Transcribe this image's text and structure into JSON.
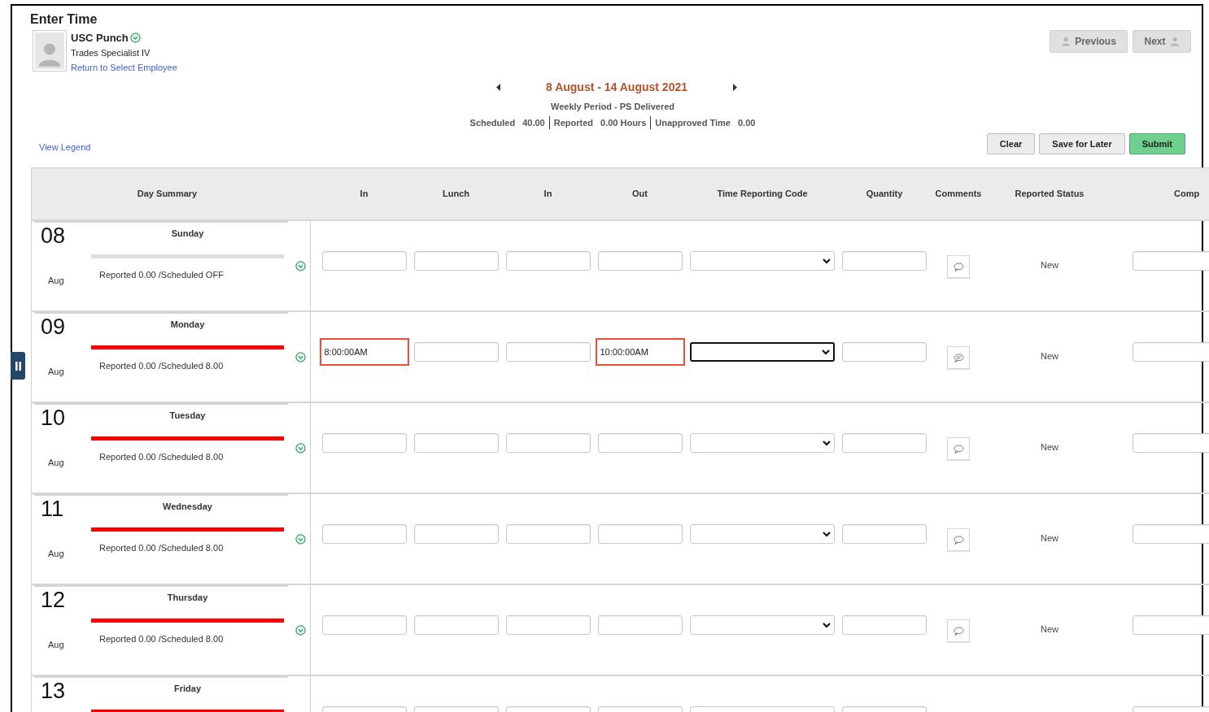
{
  "page_title": "Enter Time",
  "employee": {
    "name": "USC Punch",
    "job": "Trades Specialist IV",
    "return_link": "Return to Select Employee"
  },
  "nav_buttons": [
    "Previous",
    "Next"
  ],
  "period": {
    "title": "8 August - 14 August 2021",
    "subtitle": "Weekly Period - PS Delivered",
    "totals": [
      {
        "label": "Scheduled",
        "value": "40.00"
      },
      {
        "label": "Reported",
        "value": "0.00 Hours"
      },
      {
        "label": "Unapproved Time",
        "value": "0.00"
      }
    ]
  },
  "legend_link": "View Legend",
  "actions": [
    {
      "label": "Clear",
      "kind": "plain"
    },
    {
      "label": "Save for Later",
      "kind": "plain"
    },
    {
      "label": "Submit",
      "kind": "primary"
    }
  ],
  "columns": [
    "Day Summary",
    "In",
    "Lunch",
    "In",
    "Out",
    "Time Reporting Code",
    "Quantity",
    "Comments",
    "Reported Status",
    "Comp"
  ],
  "days": [
    {
      "date": "08",
      "weekday": "Sunday",
      "month": "Aug",
      "color": "#dddddd",
      "summary": "Reported 0.00 /Scheduled OFF",
      "punches": [
        {
          "error": false
        },
        {
          "error": false
        },
        {
          "error": false
        },
        {
          "error": false
        }
      ],
      "trc_focused": false,
      "comment_filled": false,
      "status": "New"
    },
    {
      "date": "09",
      "weekday": "Monday",
      "month": "Aug",
      "color": "#ff0000",
      "summary": "Reported 0.00 /Scheduled 8.00",
      "punches": [
        {
          "value": "8:00:00AM",
          "error": true
        },
        {
          "error": false
        },
        {
          "error": false
        },
        {
          "value": "10:00:00AM",
          "error": true
        }
      ],
      "trc_focused": true,
      "comment_filled": true,
      "status": "New"
    },
    {
      "date": "10",
      "weekday": "Tuesday",
      "month": "Aug",
      "color": "#ff0000",
      "summary": "Reported 0.00 /Scheduled 8.00",
      "punches": [
        {
          "error": false
        },
        {
          "error": false
        },
        {
          "error": false
        },
        {
          "error": false
        }
      ],
      "trc_focused": false,
      "comment_filled": false,
      "status": "New"
    },
    {
      "date": "11",
      "weekday": "Wednesday",
      "month": "Aug",
      "color": "#ff0000",
      "summary": "Reported 0.00 /Scheduled 8.00",
      "punches": [
        {
          "error": false
        },
        {
          "error": false
        },
        {
          "error": false
        },
        {
          "error": false
        }
      ],
      "trc_focused": false,
      "comment_filled": false,
      "status": "New"
    },
    {
      "date": "12",
      "weekday": "Thursday",
      "month": "Aug",
      "color": "#ff0000",
      "summary": "Reported 0.00 /Scheduled 8.00",
      "punches": [
        {
          "error": false
        },
        {
          "error": false
        },
        {
          "error": false
        },
        {
          "error": false
        }
      ],
      "trc_focused": false,
      "comment_filled": false,
      "status": "New"
    },
    {
      "date": "13",
      "weekday": "Friday",
      "color": "#ff0000"
    }
  ]
}
